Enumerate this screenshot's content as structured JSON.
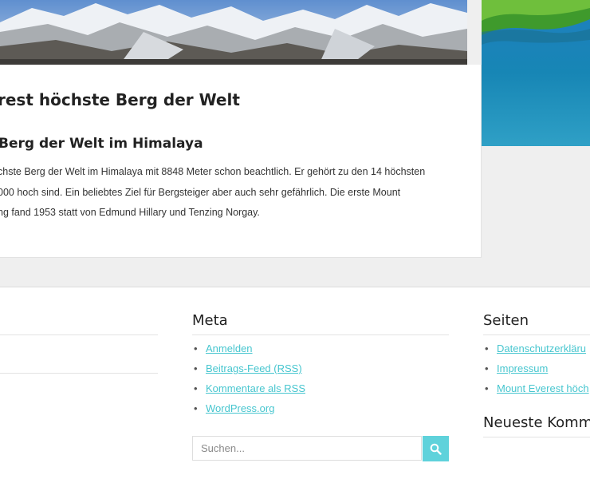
{
  "article": {
    "title": "rest höchste Berg der Welt",
    "subtitle": "Berg der Welt im Himalaya",
    "body_lines": [
      "chste Berg der Welt im Himalaya mit 8848 Meter schon beachtlich. Er gehört zu den 14 höchsten",
      "000 hoch sind. Ein beliebtes Ziel für Bergsteiger aber auch sehr gefährlich. Die erste Mount",
      "ng fand 1953 statt von Edmund Hillary und Tenzing Norgay."
    ]
  },
  "footer": {
    "meta": {
      "title": "Meta",
      "links": [
        "Anmelden",
        "Beitrags-Feed (RSS)",
        "Kommentare als RSS",
        "WordPress.org"
      ]
    },
    "seiten": {
      "title": "Seiten",
      "links": [
        "Datenschutzerkläru",
        "Impressum",
        "Mount Everest höch"
      ]
    },
    "recent_comments": {
      "title": "Neueste Komme"
    },
    "search": {
      "placeholder": "Suchen..."
    }
  },
  "colors": {
    "link": "#47c6cf",
    "search_button": "#5fd2db",
    "page_background": "#efefef"
  },
  "icons": {
    "search_button_icon": "search-icon"
  }
}
